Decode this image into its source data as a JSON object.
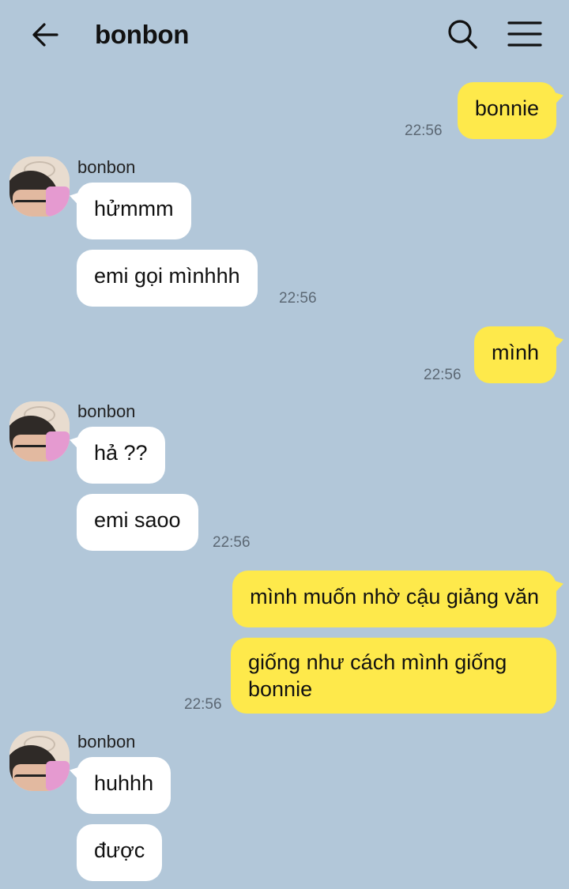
{
  "header": {
    "title": "bonbon",
    "back_icon": "arrow-left-icon",
    "search_icon": "search-icon",
    "menu_icon": "hamburger-menu-icon"
  },
  "colors": {
    "background": "#b2c7d9",
    "incoming_bubble": "#ffffff",
    "outgoing_bubble": "#fee94b",
    "timestamp": "#5c6874"
  },
  "messages": [
    {
      "side": "out",
      "text": "bonnie",
      "time": "22:56"
    },
    {
      "side": "in",
      "sender": "bonbon",
      "text": "hửmmm"
    },
    {
      "side": "in",
      "text": "emi gọi mìnhhh",
      "time": "22:56"
    },
    {
      "side": "out",
      "text": "mình",
      "time": "22:56"
    },
    {
      "side": "in",
      "sender": "bonbon",
      "text": "hả ??"
    },
    {
      "side": "in",
      "text": "emi saoo",
      "time": "22:56"
    },
    {
      "side": "out",
      "text": "mình muốn nhờ cậu giảng văn"
    },
    {
      "side": "out",
      "text": "giống như cách mình giống bonnie",
      "time": "22:56"
    },
    {
      "side": "in",
      "sender": "bonbon",
      "text": "huhhh"
    },
    {
      "side": "in",
      "text": "được"
    }
  ]
}
